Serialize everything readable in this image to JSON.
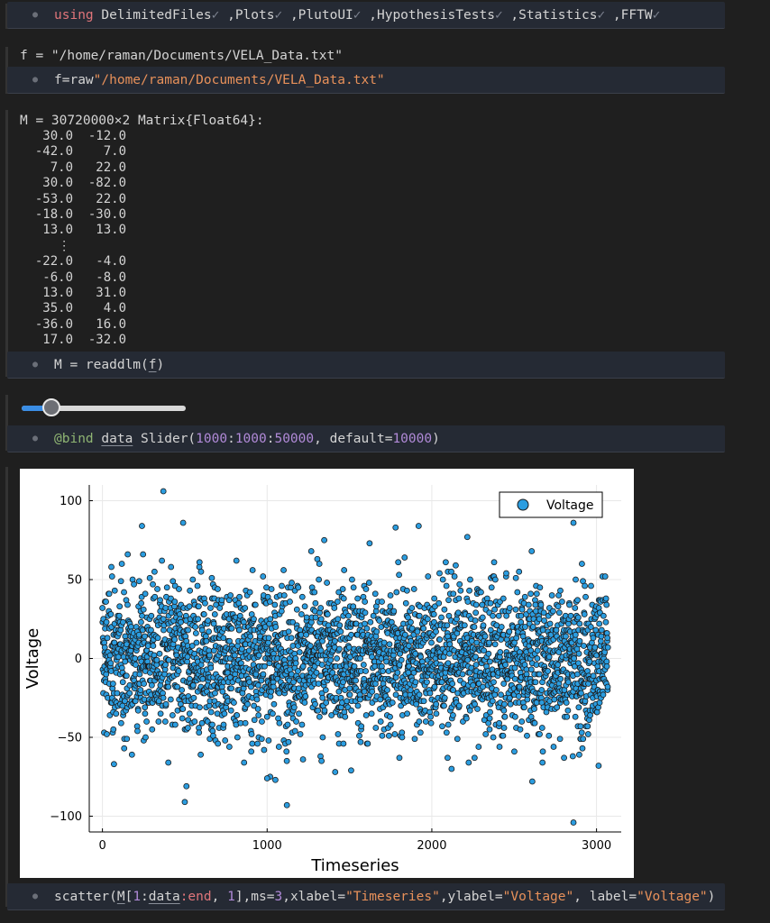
{
  "cells": {
    "using": {
      "keyword": "using",
      "packages": [
        "DelimitedFiles",
        "Plots",
        "PlutoUI",
        "HypothesisTests",
        "Statistics",
        "FFTW"
      ],
      "check": "✓",
      "sep": ","
    },
    "file": {
      "output_text": "f = \"/home/raman/Documents/VELA_Data.txt\"",
      "code_var": "f=raw",
      "code_str": "\"/home/raman/Documents/VELA_Data.txt\""
    },
    "matrix": {
      "header": "M = 30720000×2 Matrix{Float64}:",
      "rows_top": [
        [
          "30.0",
          "-12.0"
        ],
        [
          "-42.0",
          "7.0"
        ],
        [
          "7.0",
          "22.0"
        ],
        [
          "30.0",
          "-82.0"
        ],
        [
          "-53.0",
          "22.0"
        ],
        [
          "-18.0",
          "-30.0"
        ],
        [
          "13.0",
          "13.0"
        ]
      ],
      "ellipsis": "⋮",
      "rows_bottom": [
        [
          "-22.0",
          "-4.0"
        ],
        [
          "-6.0",
          "-8.0"
        ],
        [
          "13.0",
          "31.0"
        ],
        [
          "35.0",
          "4.0"
        ],
        [
          "-36.0",
          "16.0"
        ],
        [
          "17.0",
          "-32.0"
        ]
      ],
      "code_left": "M = readdlm(",
      "code_arg": "f",
      "code_right": ")"
    },
    "slider": {
      "value": 10000,
      "min": 1000,
      "max": 50000,
      "code_macro": "@bind",
      "code_var": "data",
      "code_fn": " Slider(",
      "range_a": "1000",
      "colon1": ":",
      "range_b": "1000",
      "colon2": ":",
      "range_c": "50000",
      "code_mid": ", default=",
      "default": "10000",
      "code_end": ")"
    },
    "plot": {
      "code_fn": "scatter(",
      "code_M": "M",
      "code_open": "[",
      "code_one": "1",
      "code_colon": ":",
      "code_data": "data",
      "code_end_kw": ":end",
      "code_comma": ", ",
      "code_col": "1",
      "code_ms": "],ms=",
      "code_ms_val": "3",
      "code_xl": ",xlabel=",
      "code_xl_val": "\"Timeseries\"",
      "code_yl": ",ylabel=",
      "code_yl_val": "\"Voltage\"",
      "code_lb": ", label=",
      "code_lb_val": "\"Voltage\"",
      "code_close": ")"
    }
  },
  "chart_data": {
    "type": "scatter",
    "xlabel": "Timeseries",
    "ylabel": "Voltage",
    "legend": "Voltage",
    "legend_position": "top-right",
    "xlim": [
      -80,
      3150
    ],
    "ylim": [
      -110,
      110
    ],
    "xticks": [
      0,
      1000,
      2000,
      3000
    ],
    "yticks": [
      -100,
      -50,
      0,
      50,
      100
    ],
    "ytick_labels": [
      "−100",
      "−50",
      "0",
      "50",
      "100"
    ],
    "marker_color": "#2b9de0",
    "marker_edge": "#1a1a1a",
    "grid": true,
    "n_points": 3000,
    "spread_sd": 24,
    "outliers": [
      {
        "x": 370,
        "y": 106
      },
      {
        "x": 490,
        "y": 86
      },
      {
        "x": 240,
        "y": 84
      },
      {
        "x": 1780,
        "y": 83
      },
      {
        "x": 1920,
        "y": 84
      },
      {
        "x": 2860,
        "y": 86
      },
      {
        "x": 500,
        "y": -91
      },
      {
        "x": 510,
        "y": -81
      },
      {
        "x": 1000,
        "y": -76
      },
      {
        "x": 1050,
        "y": -77
      },
      {
        "x": 1120,
        "y": -93
      },
      {
        "x": 2610,
        "y": -78
      },
      {
        "x": 2860,
        "y": -104
      },
      {
        "x": 70,
        "y": -67
      },
      {
        "x": 860,
        "y": -66
      },
      {
        "x": 400,
        "y": -66
      },
      {
        "x": 1510,
        "y": -71
      },
      {
        "x": 2120,
        "y": -70
      }
    ]
  }
}
